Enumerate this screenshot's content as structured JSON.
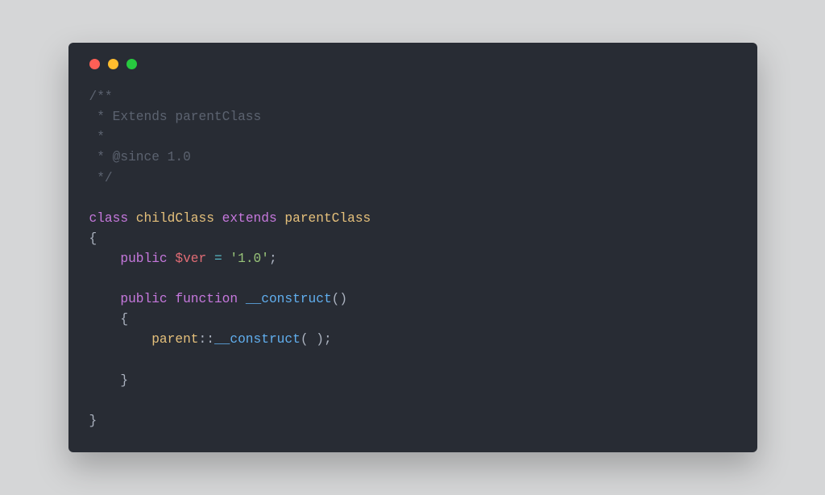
{
  "colors": {
    "page_bg": "#d5d6d7",
    "window_bg": "#282c34",
    "text_default": "#abb2bf",
    "comment": "#5c6370",
    "keyword": "#c678dd",
    "classname": "#e5c07b",
    "variable": "#e06c75",
    "operator": "#56b6c2",
    "string": "#98c379",
    "function": "#61afef",
    "dot_red": "#ff5f56",
    "dot_yellow": "#ffbd2e",
    "dot_green": "#27c93f"
  },
  "code": {
    "c1": "/**",
    "c2": " * Extends parentClass",
    "c3": " *",
    "c4": " * @since 1.0",
    "c5": " */",
    "blank": "",
    "kw_class": "class",
    "cls_child": "childClass",
    "kw_extends": "extends",
    "cls_parent": "parentClass",
    "brace_open": "{",
    "indent1": "    ",
    "kw_public1": "public",
    "var_ver": "$ver",
    "op_eq": "= ",
    "str_ver": "'1.0'",
    "semi": ";",
    "kw_public2": "public",
    "kw_function": "function",
    "fn_construct": "__construct",
    "parens": "()",
    "indent2": "        ",
    "parent_tok": "parent",
    "dbl_colon": "::",
    "call_construct": "__construct",
    "call_parens": "( )",
    "brace_close": "}",
    "brace_close_outer": "}"
  }
}
